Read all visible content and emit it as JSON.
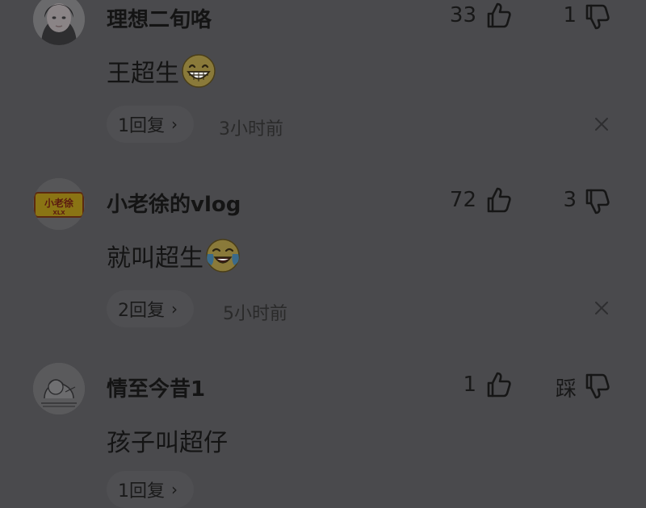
{
  "comments": [
    {
      "username": "理想二旬咯",
      "likes": "33",
      "dislikes": "1",
      "text": "王超生",
      "emoji": "grin-emoji",
      "replies_label": "1回复",
      "time": "3小时前"
    },
    {
      "username": "小老徐的vlog",
      "likes": "72",
      "dislikes": "3",
      "text": "就叫超生",
      "emoji": "laugh-cry-emoji",
      "replies_label": "2回复",
      "time": "5小时前"
    },
    {
      "username": "情至今昔1",
      "likes": "1",
      "dislikes": "踩",
      "text": "孩子叫超仔",
      "emoji": "",
      "replies_label": "1回复",
      "time": ""
    }
  ],
  "avatar_logo_text": {
    "top": "小老徐",
    "bottom": "XLX"
  },
  "icons": {
    "like": "thumbs-up-icon",
    "dislike": "thumbs-down-icon",
    "reply_chevron": "chevron-right-icon",
    "close": "close-icon"
  },
  "colors": {
    "overlay_background": "#4a4a4d",
    "text": "#141414",
    "pill_background": "#4f4f52"
  }
}
